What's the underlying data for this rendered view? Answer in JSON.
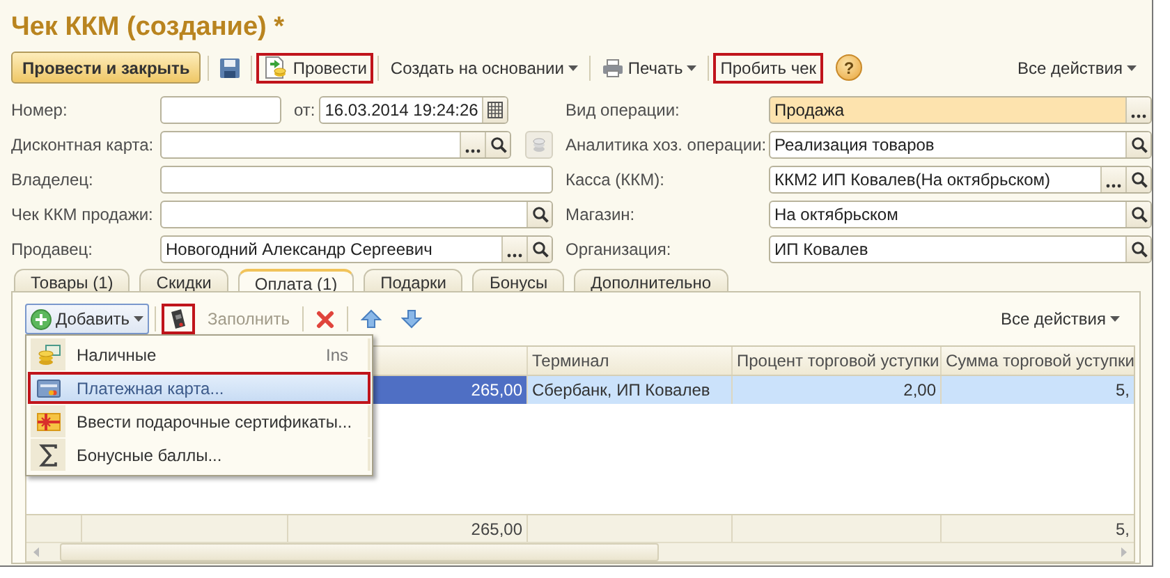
{
  "window": {
    "title": "Чек ККМ (создание) *"
  },
  "toolbar": {
    "post_and_close": {
      "label": "Провести и закрыть"
    },
    "post": {
      "label": "Провести",
      "annotated": true
    },
    "create_based_on": {
      "label": "Создать на основании"
    },
    "print": {
      "label": "Печать"
    },
    "fiscal_receipt": {
      "label": "Пробить чек",
      "annotated": true
    },
    "help": {
      "label": "?"
    },
    "all_actions": {
      "label": "Все действия"
    }
  },
  "form": {
    "left": [
      {
        "label": "Номер:",
        "date": {
          "label": "от:",
          "value": "16.03.2014 19:24:26"
        }
      },
      {
        "label": "Дисконтная карта:",
        "choice_button": true,
        "search_button": true,
        "side_button_disabled": true
      },
      {
        "label": "Владелец:"
      },
      {
        "label": "Чек ККМ продажи:",
        "search_button": true
      },
      {
        "label": "Продавец:",
        "value": "Новогодний Александр Сергеевич",
        "choice_button": true,
        "search_button": true
      }
    ],
    "right": [
      {
        "label": "Вид операции:",
        "value": "Продажа",
        "choice_button": true,
        "highlighted": true
      },
      {
        "label": "Аналитика хоз. операции:",
        "value": "Реализация товаров",
        "search_button": true,
        "highlighted": false
      },
      {
        "label": "Касса (ККМ):",
        "value": "ККМ2 ИП Ковалев(На октябрьском)",
        "choice_button": true,
        "search_button": true,
        "highlighted": false
      },
      {
        "label": "Магазин:",
        "value": "На октябрьском",
        "search_button": true,
        "highlighted": false
      },
      {
        "label": "Организация:",
        "value": "ИП Ковалев",
        "search_button": true,
        "highlighted": false
      }
    ]
  },
  "tabs": [
    {
      "label": "Товары (1)",
      "selected": false
    },
    {
      "label": "Скидки",
      "selected": false
    },
    {
      "label": "Оплата (1)",
      "selected": true
    },
    {
      "label": "Подарки",
      "selected": false
    },
    {
      "label": "Бонусы",
      "selected": false
    },
    {
      "label": "Дополнительно",
      "selected": false
    }
  ],
  "payments": {
    "toolbar": {
      "add": {
        "label": "Добавить"
      },
      "terminal": {
        "annotated": true
      },
      "fill": {
        "label": "Заполнить",
        "disabled": true
      },
      "all_actions": {
        "label": "Все действия"
      }
    },
    "table": {
      "columns": [
        "Терминал",
        "Процент торговой уступки",
        "Сумма торговой уступки"
      ],
      "rows": [
        {
          "selected": true,
          "column_3": "265,00",
          "cells": [
            "Сбербанк, ИП Ковалев",
            "2,00",
            "5,"
          ]
        }
      ],
      "totals": {
        "column_3": "265,00",
        "column_6": "5,"
      }
    },
    "add_menu": {
      "items": [
        {
          "label": "Наличные",
          "shortcut": "Ins",
          "selected": false,
          "annotated": false
        },
        {
          "label": "Платежная карта...",
          "selected": true,
          "annotated": true
        },
        {
          "label": "Ввести подарочные сертификаты...",
          "selected": false,
          "annotated": false
        },
        {
          "label": "Бонусные баллы...",
          "selected": false,
          "annotated": false
        }
      ]
    }
  }
}
